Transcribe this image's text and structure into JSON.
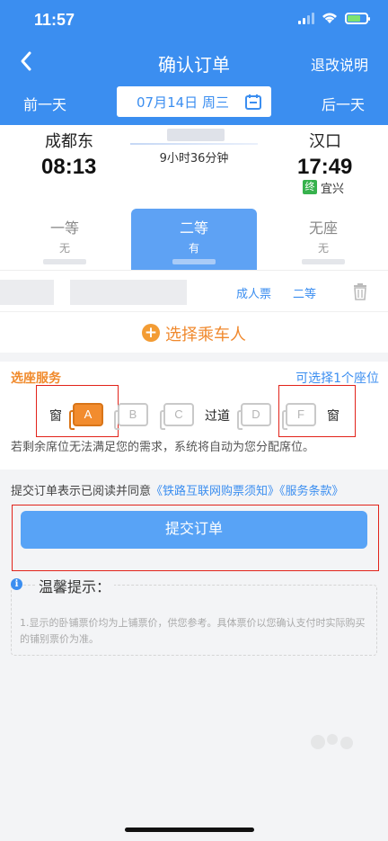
{
  "status": {
    "time": "11:57"
  },
  "nav": {
    "title": "确认订单",
    "refund_rules": "退改说明"
  },
  "datebar": {
    "prev": "前一天",
    "next": "后一天",
    "date": "07月14日 周三"
  },
  "train": {
    "from_station": "成都东",
    "depart_time": "08:13",
    "to_station": "汉口",
    "arrive_time": "17:49",
    "duration": "9小时36分钟",
    "terminus_badge": "终",
    "terminus": "宜兴"
  },
  "seat_types": [
    {
      "name": "一等",
      "availability": "无"
    },
    {
      "name": "二等",
      "availability": "有"
    },
    {
      "name": "无座",
      "availability": "无"
    }
  ],
  "passenger": {
    "ticket_type": "成人票",
    "seat_class": "二等"
  },
  "choose_passenger": "选择乘车人",
  "seat_service": {
    "title": "选座服务",
    "limit": "可选择1个座位",
    "window_label": "窗",
    "aisle_label": "过道",
    "seats": [
      "A",
      "B",
      "C",
      "D",
      "F"
    ],
    "selected": "A",
    "note": "若剩余席位无法满足您的需求，系统将自动为您分配席位。"
  },
  "agreement": {
    "prefix": "提交订单表示已阅读并同意",
    "link1": "《铁路互联网购票须知》",
    "link2": "《服务条款》"
  },
  "submit_label": "提交订单",
  "tips": {
    "title": "温馨提示：",
    "text": "1.显示的卧铺票价均为上铺票价，供您参考。具体票价以您确认支付时实际购买的铺别票价为准。"
  },
  "colors": {
    "primary": "#3b8ef0",
    "accent": "#f28c2e",
    "highlight_box": "#e2231a"
  }
}
